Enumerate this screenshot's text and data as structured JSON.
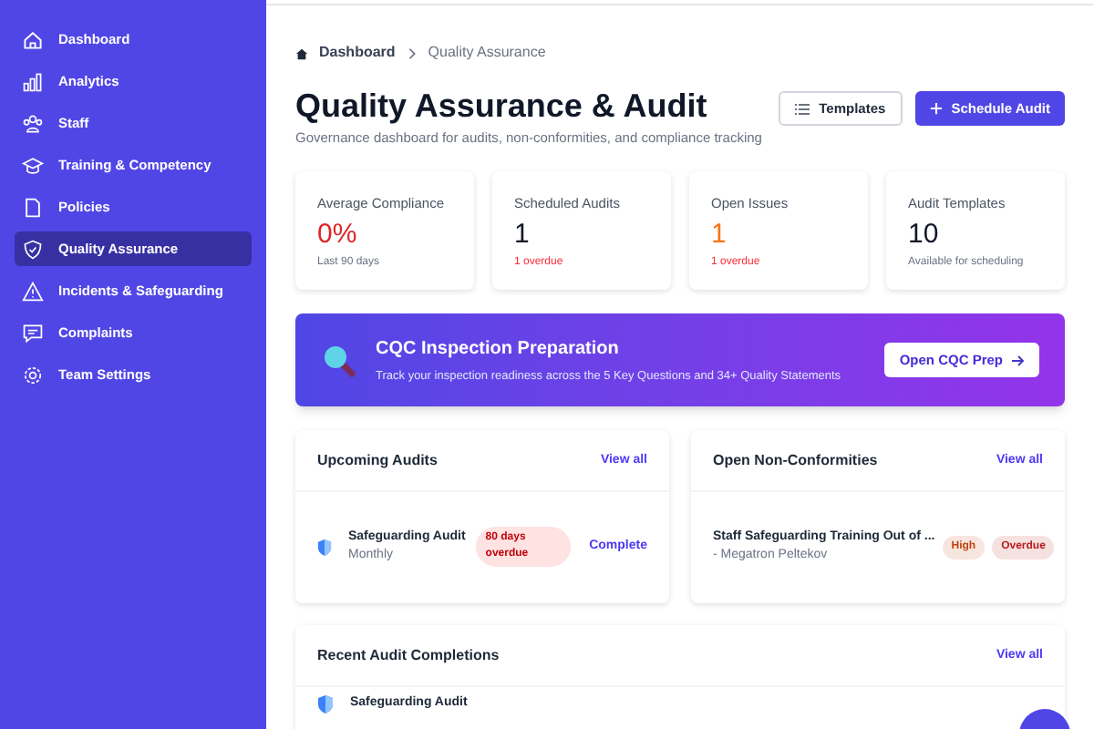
{
  "sidebar": {
    "items": [
      {
        "label": "Dashboard",
        "selected": false
      },
      {
        "label": "Analytics",
        "selected": false
      },
      {
        "label": "Staff",
        "selected": false
      },
      {
        "label": "Training & Competency",
        "selected": false
      },
      {
        "label": "Policies",
        "selected": false
      },
      {
        "label": "Quality Assurance",
        "selected": true
      },
      {
        "label": "Incidents & Safeguarding",
        "selected": false
      },
      {
        "label": "Complaints",
        "selected": false
      },
      {
        "label": "Team Settings",
        "selected": false
      }
    ]
  },
  "breadcrumb": [
    "Dashboard",
    "Quality Assurance"
  ],
  "header": {
    "title": "Quality Assurance & Audit",
    "subtitle": "Governance dashboard for audits, non-conformities, and compliance tracking",
    "buttons": [
      {
        "label": "Templates",
        "kind": "secondary"
      },
      {
        "label": "Schedule Audit",
        "kind": "primary"
      }
    ]
  },
  "stats": [
    {
      "label": "Average Compliance",
      "value": "0%",
      "color": "#dc2626",
      "note": "Last 90 days",
      "note_alert": false
    },
    {
      "label": "Scheduled Audits",
      "value": "1",
      "color": "#111827",
      "note": "1 overdue",
      "note_alert": true
    },
    {
      "label": "Open Issues",
      "value": "1",
      "color": "#f97316",
      "note": "1 overdue",
      "note_alert": true
    },
    {
      "label": "Audit Templates",
      "value": "10",
      "color": "#111827",
      "note": "Available for scheduling",
      "note_alert": false
    }
  ],
  "banner": {
    "title": "CQC Inspection Preparation",
    "text": "Track your inspection readiness across the 5 Key Questions and 34+ Quality Statements",
    "button": "Open CQC Prep"
  },
  "upcoming_audits": {
    "title": "Upcoming Audits",
    "link": "View all",
    "items": [
      {
        "name": "Safeguarding Audit",
        "frequency": "Monthly",
        "badge": "80 days overdue",
        "action": "Complete"
      }
    ]
  },
  "non_conformities": {
    "title": "Open Non-Conformities",
    "link": "View all",
    "items": [
      {
        "title": "Staff Safeguarding Training Out of ...",
        "person": "- Megatron Peltekov",
        "badges": [
          {
            "label": "High",
            "color": "#c2410c"
          },
          {
            "label": "Overdue",
            "color": "#b91c1c"
          }
        ]
      }
    ]
  },
  "recent_completions": {
    "title": "Recent Audit Completions",
    "link": "View all",
    "items": [
      {
        "name": "Safeguarding Audit"
      }
    ]
  }
}
